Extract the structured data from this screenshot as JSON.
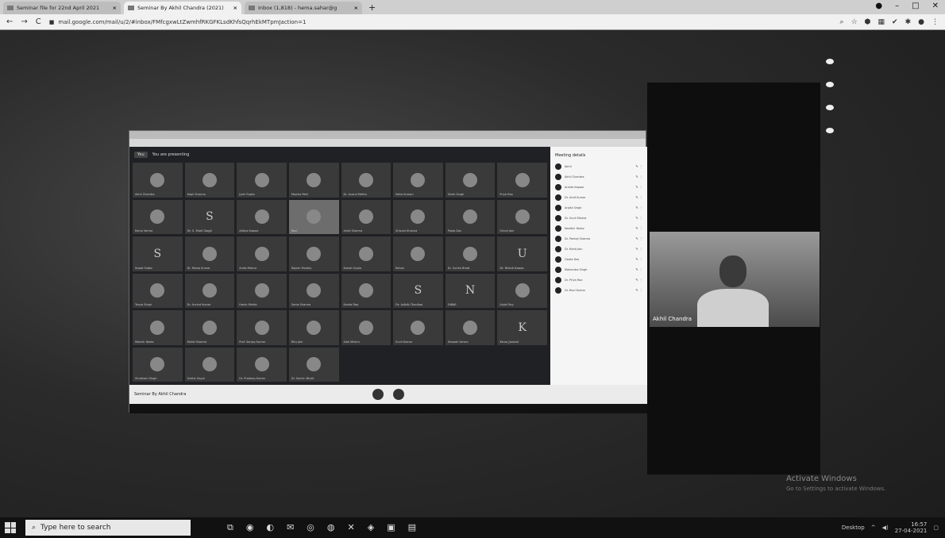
{
  "browser": {
    "tabs": [
      {
        "label": "Seminar file for 22nd April 2021",
        "active": false
      },
      {
        "label": "Seminar By Akhil Chandra (2021)",
        "active": true
      },
      {
        "label": "Inbox (1,818) - hema.sahar@g",
        "active": false
      }
    ],
    "url": "mail.google.com/mail/u/2/#inbox/FMfcgxwLtZwmhfRKGFKLsdKhfsQqrhEkMTpmJaction=1",
    "new_tab": "+",
    "window_controls": [
      "–",
      "□",
      "✕"
    ]
  },
  "meet_window": {
    "header_badge": "You",
    "header_text": "You are presenting",
    "people_title": "Meeting details",
    "bottom_title": "Seminar By Akhil Chandra",
    "participants": [
      {
        "letter": "",
        "name": "Akhil Chandra"
      },
      {
        "letter": "",
        "name": "Kapil Sharma"
      },
      {
        "letter": "",
        "name": "Jyoti Gupta"
      },
      {
        "letter": "",
        "name": "Monika Patil"
      },
      {
        "letter": "",
        "name": "Dr. Anand Mehta"
      },
      {
        "letter": "",
        "name": "Neha Kumari"
      },
      {
        "letter": "",
        "name": "Vivek Singh"
      },
      {
        "letter": "",
        "name": "Priya Rao"
      },
      {
        "letter": "",
        "name": "Rahul Verma"
      },
      {
        "letter": "S",
        "name": "Dr. S. Patel Singh"
      },
      {
        "letter": "",
        "name": "Aditya Kapoor"
      },
      {
        "letter": "",
        "name": "Ravi"
      },
      {
        "letter": "",
        "name": "Ankit Sharma"
      },
      {
        "letter": "",
        "name": "Shivani Khanna"
      },
      {
        "letter": "",
        "name": "Pooja Das"
      },
      {
        "letter": "",
        "name": "Shruti Jain"
      },
      {
        "letter": "S",
        "name": "Sumit Yadav"
      },
      {
        "letter": "",
        "name": "Dr. Manoj Kumar"
      },
      {
        "letter": "",
        "name": "Anita Mishra"
      },
      {
        "letter": "",
        "name": "Rajesh Pandey"
      },
      {
        "letter": "",
        "name": "Komal Gupta"
      },
      {
        "letter": "",
        "name": "Rohan"
      },
      {
        "letter": "",
        "name": "Dr. Sunita Bhatt"
      },
      {
        "letter": "U",
        "name": "Dr. Ritesh Kumar"
      },
      {
        "letter": "",
        "name": "Tanya Singh"
      },
      {
        "letter": "",
        "name": "Dr. Arvind Kumar"
      },
      {
        "letter": "",
        "name": "Harsh Mehta"
      },
      {
        "letter": "",
        "name": "Sonia Sharma"
      },
      {
        "letter": "",
        "name": "Kavita Rao"
      },
      {
        "letter": "S",
        "name": "Dr. Ashok Chauhan"
      },
      {
        "letter": "N",
        "name": "Nikhil"
      },
      {
        "letter": "",
        "name": "Anjali Roy"
      },
      {
        "letter": "",
        "name": "Manish Yadav"
      },
      {
        "letter": "",
        "name": "Mohit Sharma"
      },
      {
        "letter": "",
        "name": "Prof. Sanjay Kumar"
      },
      {
        "letter": "",
        "name": "Ritu Jain"
      },
      {
        "letter": "",
        "name": "Alok Mishra"
      },
      {
        "letter": "",
        "name": "Sunil Kumar"
      },
      {
        "letter": "",
        "name": "Deepak Verma"
      },
      {
        "letter": "K",
        "name": "Kiran Jaiswal"
      },
      {
        "letter": "",
        "name": "Shubham Singh"
      },
      {
        "letter": "",
        "name": "Sneha Goyal"
      },
      {
        "letter": "",
        "name": "Dr. Pradeep Kumar"
      },
      {
        "letter": "",
        "name": "Dr. Sachin Bhatt"
      }
    ],
    "people_list": [
      "Akhil",
      "Akhil Chandra",
      "Ankita Kapoor",
      "Dr. Amit Kumar",
      "Arpita Singh",
      "Dr. Sunil Mishra",
      "Nandini Yadav",
      "Dr. Pankaj Sharma",
      "Dr. Rohit Jain",
      "Geeta Das",
      "Mahendra Singh",
      "Dr. Priya Rao",
      "Dr. Ravi Kumar"
    ]
  },
  "speaker": {
    "label": "Akhil Chandra"
  },
  "watermark": {
    "line1": "Activate Windows",
    "line2": "Go to Settings to activate Windows."
  },
  "taskbar": {
    "search_placeholder": "Type here to search",
    "apps": [
      "⧉",
      "◉",
      "◐",
      "✉",
      "◎",
      "◍",
      "✕",
      "◈",
      "▣",
      "▤"
    ],
    "tray_label": "Desktop",
    "time": "16:57",
    "date": "27-04-2021"
  }
}
